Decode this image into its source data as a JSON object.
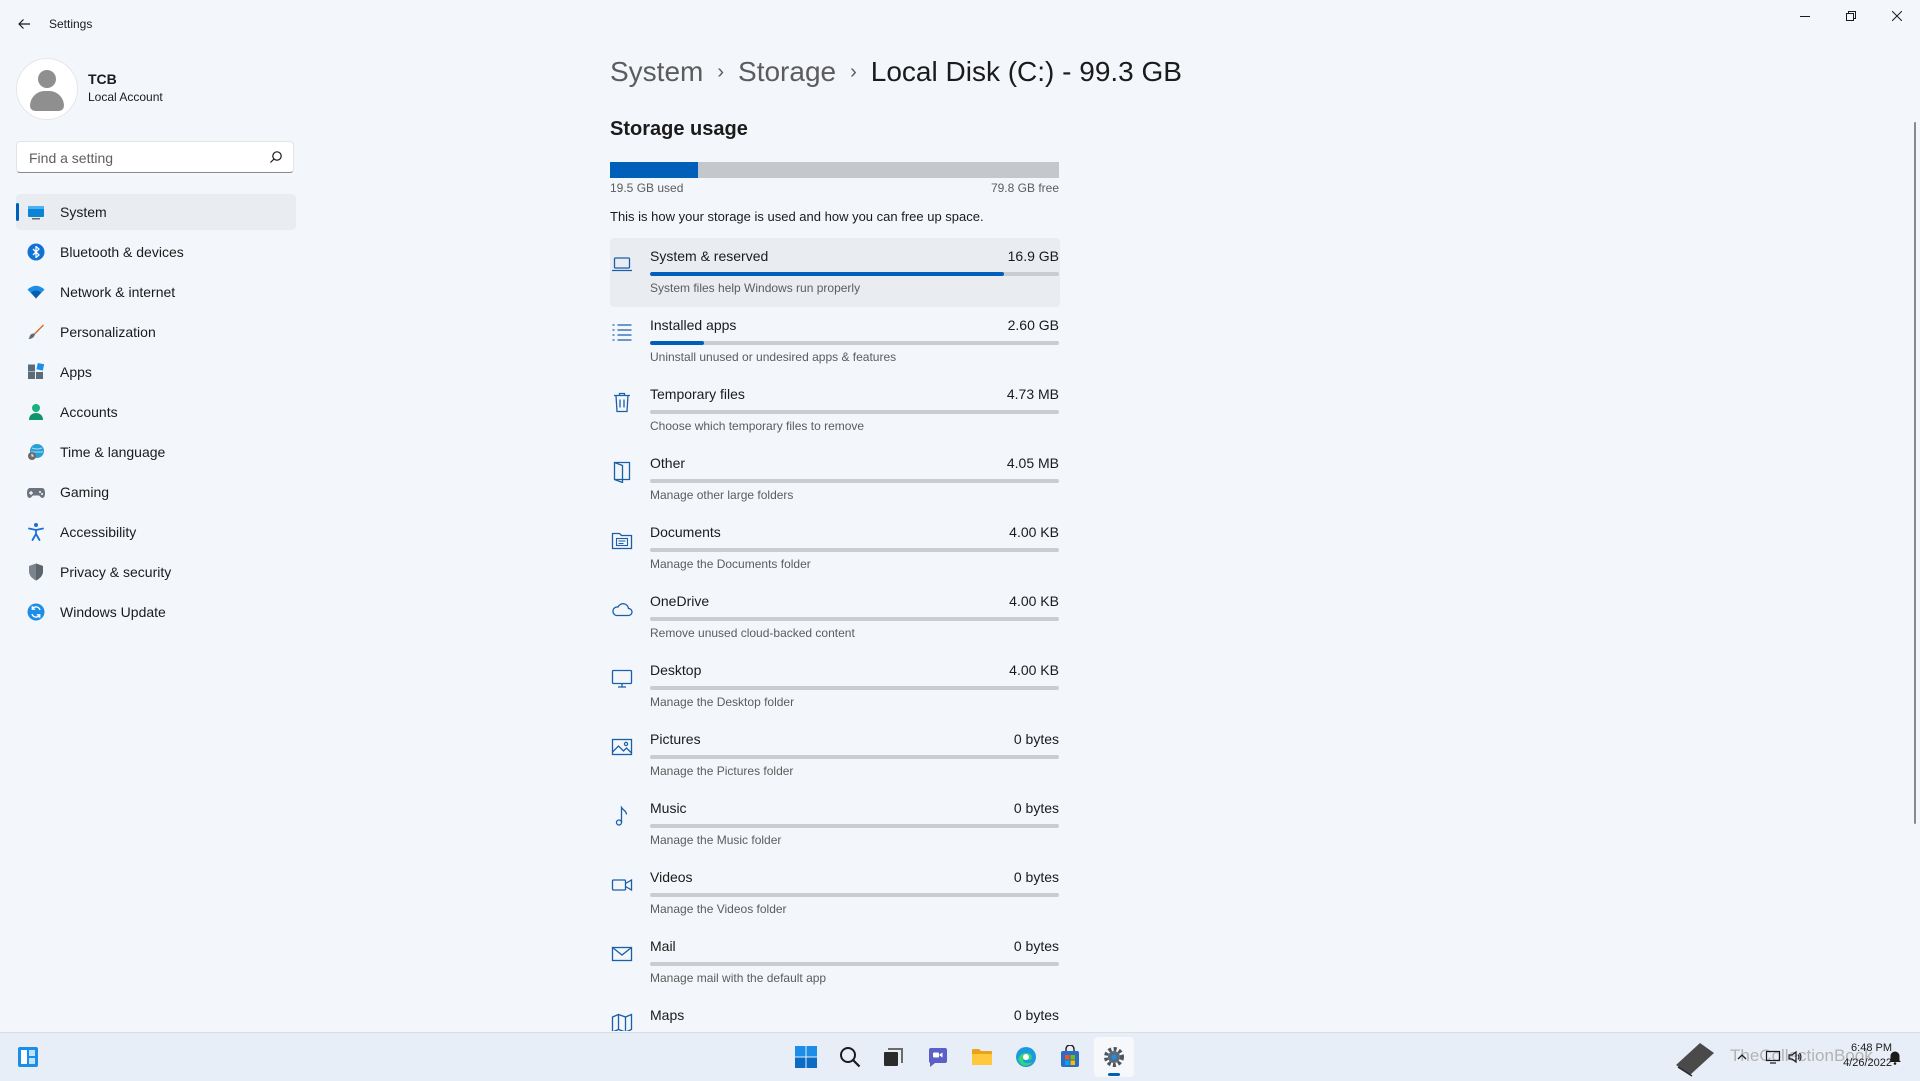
{
  "window": {
    "title": "Settings"
  },
  "profile": {
    "name": "TCB",
    "account_type": "Local Account"
  },
  "search": {
    "placeholder": "Find a setting"
  },
  "nav": {
    "items": [
      {
        "label": "System",
        "icon": "system-icon",
        "active": true
      },
      {
        "label": "Bluetooth & devices",
        "icon": "bluetooth-icon"
      },
      {
        "label": "Network & internet",
        "icon": "wifi-icon"
      },
      {
        "label": "Personalization",
        "icon": "brush-icon"
      },
      {
        "label": "Apps",
        "icon": "apps-icon"
      },
      {
        "label": "Accounts",
        "icon": "accounts-icon"
      },
      {
        "label": "Time & language",
        "icon": "globe-clock-icon"
      },
      {
        "label": "Gaming",
        "icon": "gamepad-icon"
      },
      {
        "label": "Accessibility",
        "icon": "accessibility-icon"
      },
      {
        "label": "Privacy & security",
        "icon": "shield-icon"
      },
      {
        "label": "Windows Update",
        "icon": "update-icon"
      }
    ]
  },
  "breadcrumb": {
    "level1": "System",
    "level2": "Storage",
    "current": "Local Disk (C:) - 99.3 GB"
  },
  "storage": {
    "title": "Storage usage",
    "used": "19.5 GB used",
    "free": "79.8 GB free",
    "used_fraction": 0.196,
    "description": "This is how your storage is used and how you can free up space.",
    "categories": [
      {
        "name": "System & reserved",
        "size": "16.9 GB",
        "desc": "System files help Windows run properly",
        "fraction": 0.866,
        "icon": "laptop-icon"
      },
      {
        "name": "Installed apps",
        "size": "2.60 GB",
        "desc": "Uninstall unused or undesired apps & features",
        "fraction": 0.133,
        "icon": "list-icon"
      },
      {
        "name": "Temporary files",
        "size": "4.73 MB",
        "desc": "Choose which temporary files to remove",
        "fraction": 0,
        "icon": "trash-icon"
      },
      {
        "name": "Other",
        "size": "4.05 MB",
        "desc": "Manage other large folders",
        "fraction": 0,
        "icon": "folder-open-icon"
      },
      {
        "name": "Documents",
        "size": "4.00 KB",
        "desc": "Manage the Documents folder",
        "fraction": 0,
        "icon": "documents-icon"
      },
      {
        "name": "OneDrive",
        "size": "4.00 KB",
        "desc": "Remove unused cloud-backed content",
        "fraction": 0,
        "icon": "cloud-icon"
      },
      {
        "name": "Desktop",
        "size": "4.00 KB",
        "desc": "Manage the Desktop folder",
        "fraction": 0,
        "icon": "monitor-icon"
      },
      {
        "name": "Pictures",
        "size": "0 bytes",
        "desc": "Manage the Pictures folder",
        "fraction": 0,
        "icon": "image-icon"
      },
      {
        "name": "Music",
        "size": "0 bytes",
        "desc": "Manage the Music folder",
        "fraction": 0,
        "icon": "music-note-icon"
      },
      {
        "name": "Videos",
        "size": "0 bytes",
        "desc": "Manage the Videos folder",
        "fraction": 0,
        "icon": "video-camera-icon"
      },
      {
        "name": "Mail",
        "size": "0 bytes",
        "desc": "Manage mail with the default app",
        "fraction": 0,
        "icon": "mail-icon"
      },
      {
        "name": "Maps",
        "size": "0 bytes",
        "desc": "",
        "fraction": 0,
        "icon": "map-icon"
      }
    ]
  },
  "taskbar": {
    "time": "6:48 PM",
    "date": "4/26/2022",
    "watermark": "TheCollectionBook"
  },
  "colors": {
    "accent": "#005fb8",
    "background": "#f3f6fb",
    "bar_track": "#c9ccd1"
  }
}
